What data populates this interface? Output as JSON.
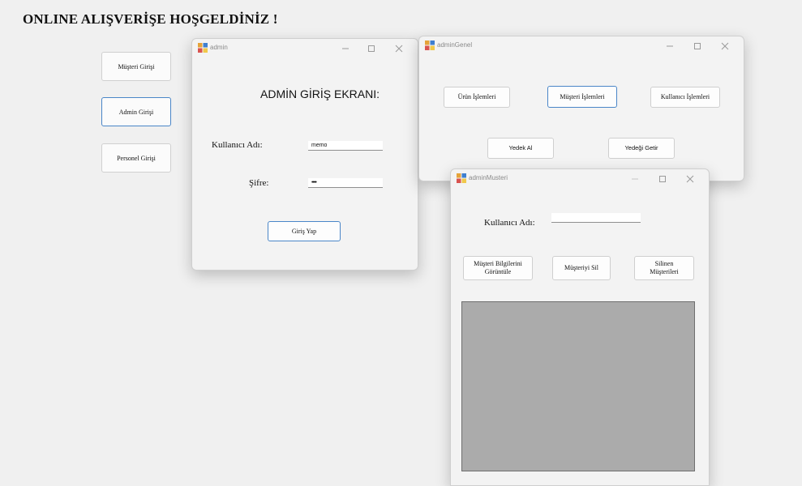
{
  "main": {
    "title": "ONLINE ALIŞVERİŞE HOŞGELDİNİZ !",
    "buttons": {
      "musteri": "Müşteri Girişi",
      "admin": "Admin Girişi",
      "personel": "Personel Girişi"
    }
  },
  "admin_window": {
    "title": "admin",
    "heading": "ADMİN GİRİŞ EKRANI:",
    "username_label": "Kullanıcı Adı:",
    "username_value": "memo",
    "password_label": "Şifre:",
    "password_value": "••••",
    "login_button": "Giriş Yap"
  },
  "admin_genel_window": {
    "title": "adminGenel",
    "buttons": {
      "urun": "Ürün İşlemleri",
      "musteri": "Müşteri İşlemleri",
      "kullanici": "Kullanıcı İşlemleri",
      "yedek_al": "Yedek Al",
      "yedek_getir": "Yedeği Getir"
    }
  },
  "admin_musteri_window": {
    "title": "adminMusteri",
    "username_label": "Kullanıcı Adı:",
    "username_value": "",
    "buttons": {
      "goruntule": "Müşteri Bilgilerini Görüntüle",
      "sil": "Müşteriyi Sil",
      "silinen": "Silinen Müşterileri"
    }
  },
  "colors": {
    "background": "#f0f0f0",
    "focus_border": "#4a86c8",
    "grid_fill": "#ababab"
  },
  "icons": {
    "app": "winforms-app-icon",
    "minimize": "minimize-icon",
    "maximize": "maximize-icon",
    "close": "close-icon"
  }
}
